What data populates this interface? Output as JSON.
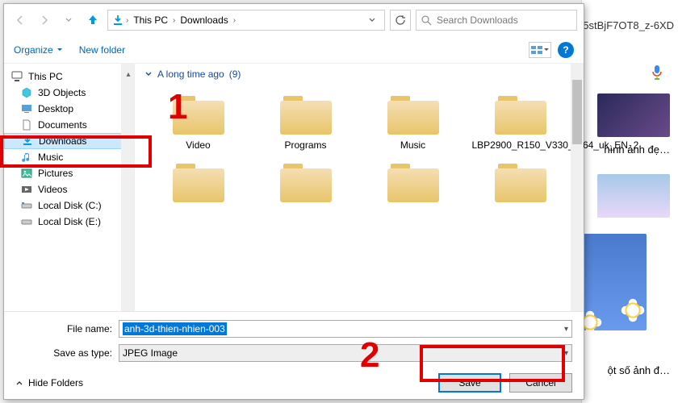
{
  "background": {
    "url_fragment": "5stBjF7OT8_z-6XD",
    "caption1": "hình ảnh đẹ…",
    "caption2": "ột số ảnh đ…"
  },
  "dialog": {
    "breadcrumb": {
      "seg1": "This PC",
      "seg2": "Downloads"
    },
    "search_placeholder": "Search Downloads",
    "toolbar": {
      "organize": "Organize",
      "newfolder": "New folder"
    },
    "tree": {
      "root": "This PC",
      "items": [
        "3D Objects",
        "Desktop",
        "Documents",
        "Downloads",
        "Music",
        "Pictures",
        "Videos",
        "Local Disk (C:)",
        "Local Disk (E:)"
      ]
    },
    "group": {
      "label": "A long time ago",
      "count": "(9)"
    },
    "folders": [
      "Video",
      "Programs",
      "Music",
      "LBP2900_R150_V330_W64_uk_EN_2",
      "",
      "",
      "",
      ""
    ],
    "filename_label": "File name:",
    "filename_value": "anh-3d-thien-nhien-003",
    "type_label": "Save as type:",
    "type_value": "JPEG Image",
    "hidefolders": "Hide Folders",
    "save": "Save",
    "cancel": "Cancel"
  },
  "annotations": {
    "one": "1",
    "two": "2"
  }
}
